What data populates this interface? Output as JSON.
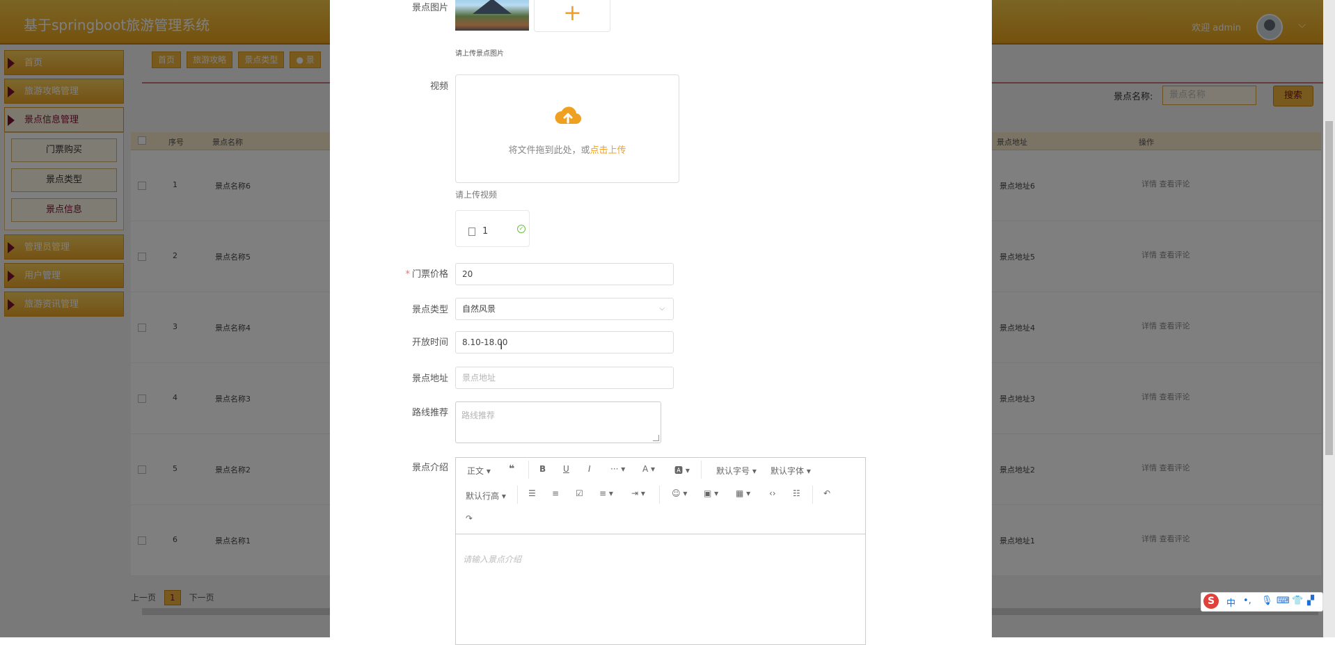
{
  "header": {
    "title": "基于springboot旅游管理系统",
    "welcome": "欢迎 admin"
  },
  "sidebar": {
    "items": [
      {
        "label": "首页"
      },
      {
        "label": "旅游攻略管理"
      },
      {
        "label": "景点信息管理"
      },
      {
        "label": "管理员管理"
      },
      {
        "label": "用户管理"
      },
      {
        "label": "旅游资讯管理"
      }
    ],
    "sub_items": [
      {
        "label": "门票购买"
      },
      {
        "label": "景点类型"
      },
      {
        "label": "景点信息"
      }
    ]
  },
  "tabs": [
    {
      "label": "首页"
    },
    {
      "label": "旅游攻略"
    },
    {
      "label": "景点类型"
    },
    {
      "label": "● 景"
    }
  ],
  "search": {
    "label": "景点名称:",
    "placeholder": "景点名称",
    "button": "搜索"
  },
  "table": {
    "headers": {
      "index": "序号",
      "name": "景点名称",
      "address": "景点地址",
      "ops": "操作"
    },
    "rows": [
      {
        "index": "1",
        "name": "景点名称6",
        "address": "景点地址6",
        "ops": "详情 查看评论"
      },
      {
        "index": "2",
        "name": "景点名称5",
        "address": "景点地址5",
        "ops": "详情 查看评论"
      },
      {
        "index": "3",
        "name": "景点名称4",
        "address": "景点地址4",
        "ops": "详情 查看评论"
      },
      {
        "index": "4",
        "name": "景点名称3",
        "address": "景点地址3",
        "ops": "详情 查看评论"
      },
      {
        "index": "5",
        "name": "景点名称2",
        "address": "景点地址2",
        "ops": "详情 查看评论"
      },
      {
        "index": "6",
        "name": "景点名称1",
        "address": "景点地址1",
        "ops": "详情 查看评论"
      }
    ]
  },
  "pager": {
    "prev": "上一页",
    "current": "1",
    "next": "下一页"
  },
  "form": {
    "image_label": "景点图片",
    "image_tip": "请上传景点图片",
    "plus": "+",
    "video_label": "视频",
    "drag_text": "将文件拖到此处，或",
    "drag_link": "点击上传",
    "video_tip": "请上传视频",
    "file_name": "1",
    "price_required": "*",
    "price_label": "门票价格",
    "price_value": "20",
    "type_label": "景点类型",
    "type_value": "自然风景",
    "open_label": "开放时间",
    "open_value": "8.10-18.00",
    "address_label": "景点地址",
    "address_placeholder": "景点地址",
    "route_label": "路线推荐",
    "route_placeholder": "路线推荐",
    "intro_label": "景点介绍",
    "intro_placeholder": "请输入景点介绍"
  },
  "editor_toolbar": {
    "paragraph": "正文",
    "font_size": "默认字号",
    "font_family": "默认字体",
    "line_height": "默认行高"
  },
  "ime": {
    "logo": "S",
    "lang": "中"
  },
  "colors": {
    "accent": "#f0a020",
    "brand": "#7b1233",
    "header": "#e9a31c"
  }
}
